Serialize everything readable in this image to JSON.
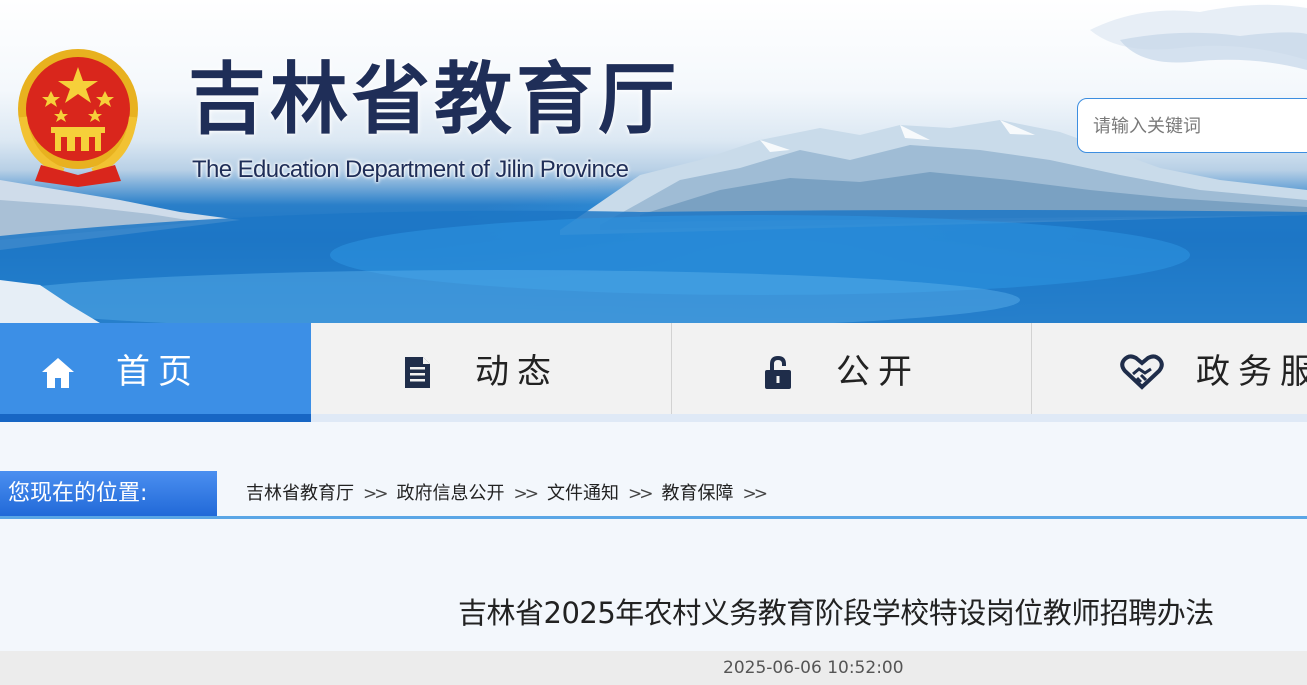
{
  "header": {
    "title": "吉林省教育厅",
    "subtitle": "The Education Department of Jilin Province",
    "emblem_icon": "national-emblem-icon"
  },
  "search": {
    "placeholder": "请输入关键词"
  },
  "nav": {
    "items": [
      {
        "label": "首页",
        "icon": "home-icon",
        "active": true
      },
      {
        "label": "动态",
        "icon": "document-icon",
        "active": false
      },
      {
        "label": "公开",
        "icon": "lock-icon",
        "active": false
      },
      {
        "label": "政务服务",
        "icon": "heart-handshake-icon",
        "active": false
      }
    ]
  },
  "breadcrumb": {
    "label": "您现在的位置:",
    "items": [
      "吉林省教育厅",
      "政府信息公开",
      "文件通知",
      "教育保障"
    ],
    "separator": ">>"
  },
  "article": {
    "title": "吉林省2025年农村义务教育阶段学校特设岗位教师招聘办法",
    "datetime": "2025-06-06 10:52:00"
  },
  "colors": {
    "nav_active": "#3c8fe6",
    "nav_inactive": "#f2f2f2",
    "title_navy": "#1f2e58",
    "crumb_label_bg": "#2169d8"
  }
}
